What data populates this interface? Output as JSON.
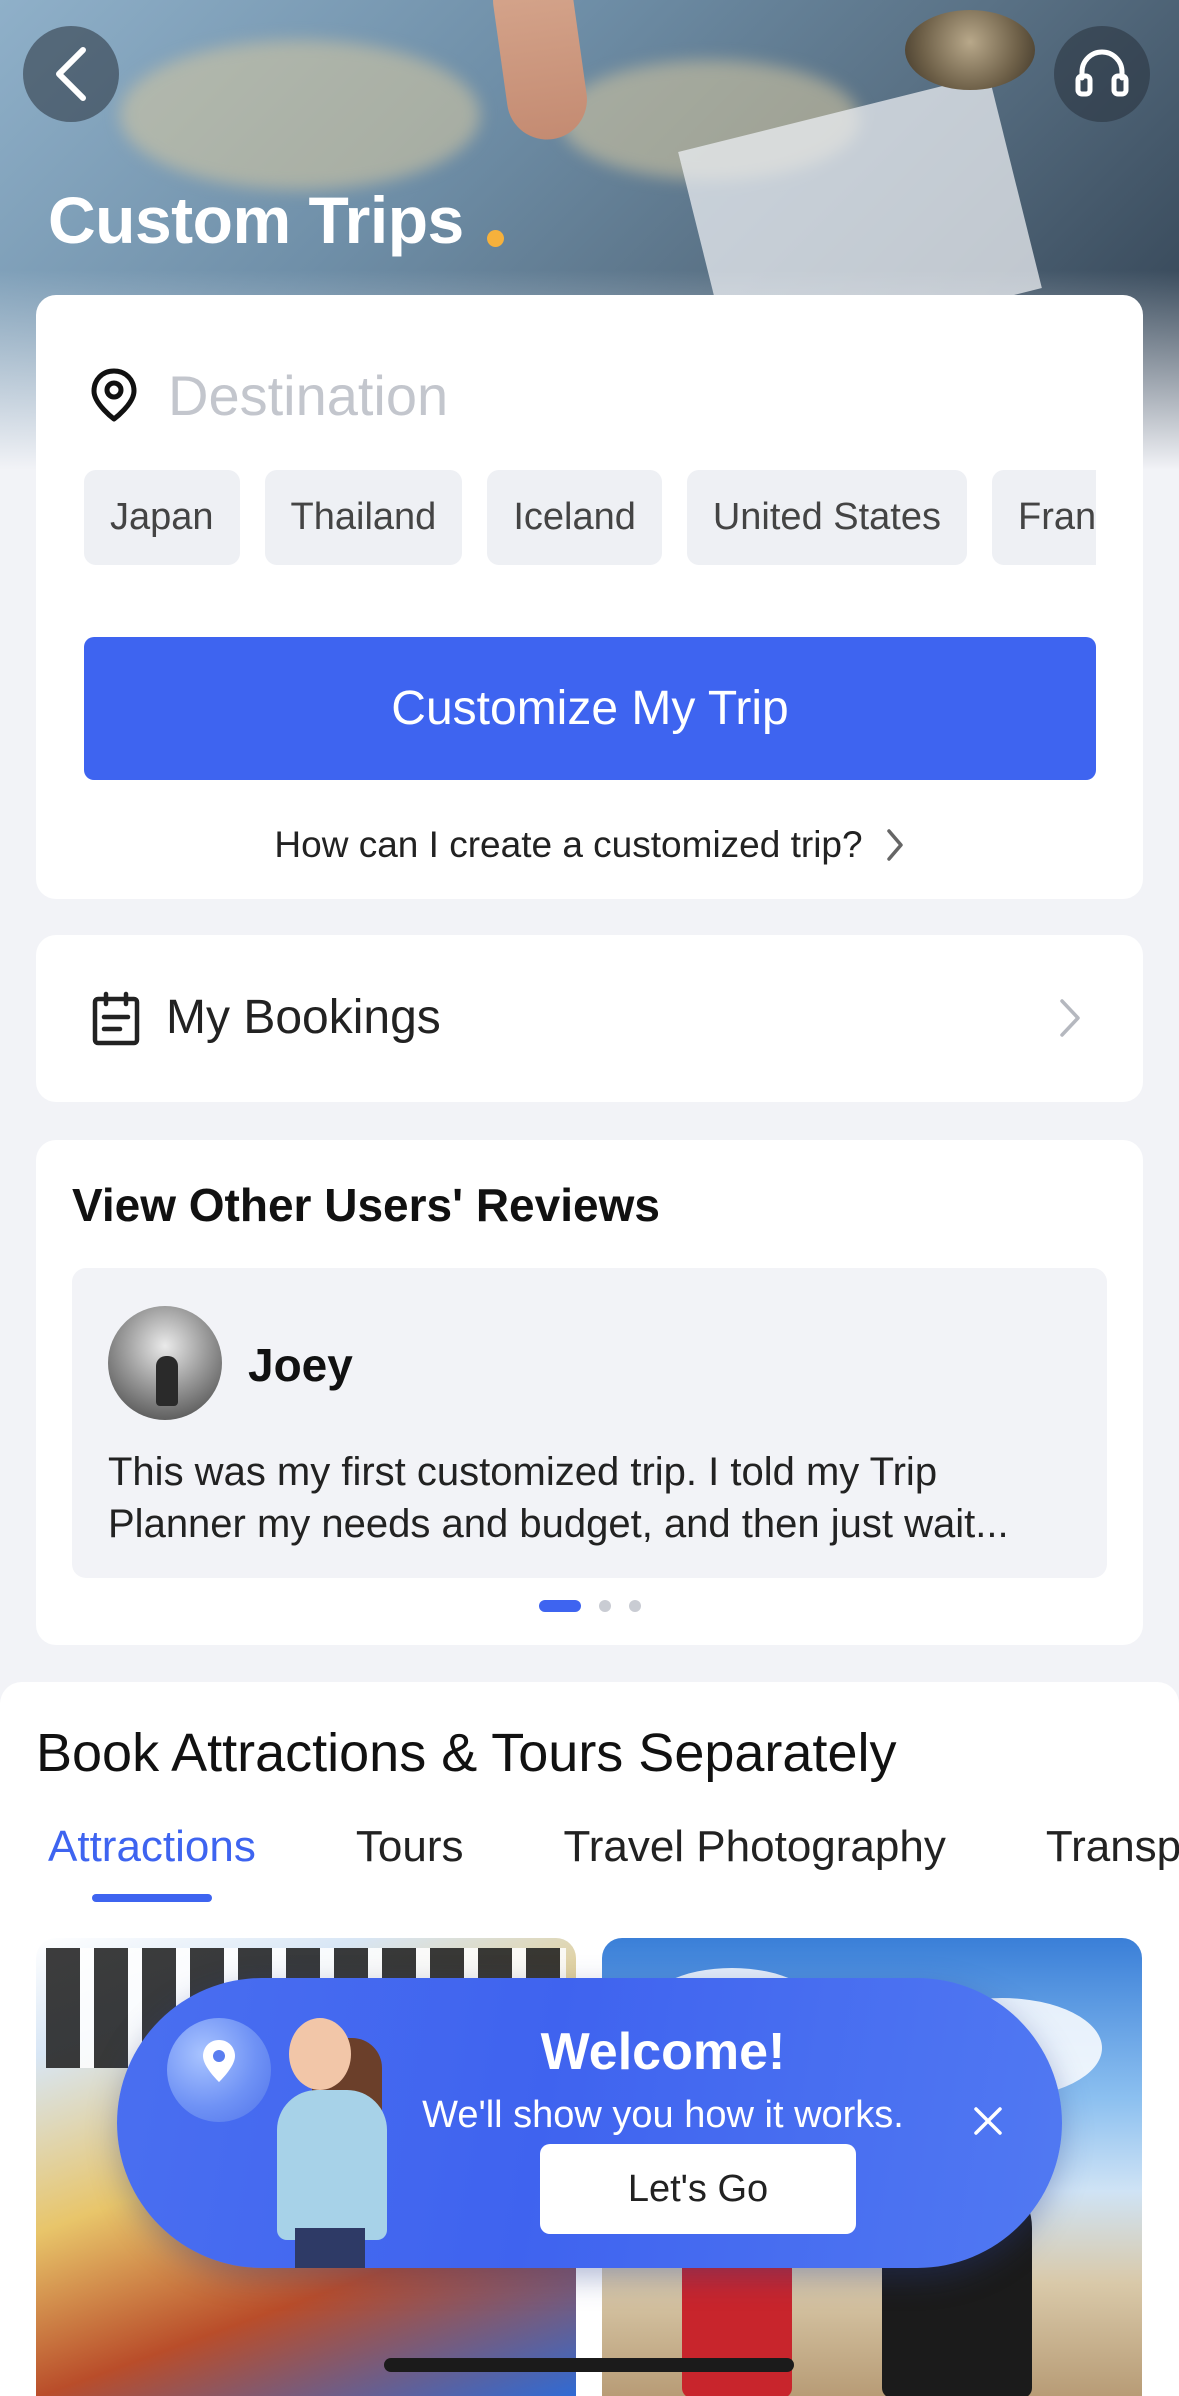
{
  "header": {
    "title": "Custom Trips",
    "accent_color": "#f6b13c",
    "back_icon": "chevron-left-icon",
    "support_icon": "headset-icon"
  },
  "search": {
    "placeholder": "Destination",
    "location_icon": "location-pin-icon",
    "chips": [
      "Japan",
      "Thailand",
      "Iceland",
      "United States",
      "Franc"
    ],
    "primary_button": "Customize My Trip",
    "help_link": "How can I create a customized trip?",
    "brand_color": "#3e64f0"
  },
  "bookings": {
    "label": "My Bookings",
    "icon": "clipboard-icon"
  },
  "reviews": {
    "title": "View Other Users' Reviews",
    "reviewer": "Joey",
    "text": "This was my first customized trip. I told my Trip Planner my needs and budget, and then just wait...",
    "page_count": 3,
    "active_page": 1
  },
  "attractions": {
    "title": "Book Attractions & Tours Separately",
    "tabs": [
      "Attractions",
      "Tours",
      "Travel Photography",
      "Transport"
    ],
    "active_tab": "Attractions"
  },
  "welcome": {
    "title": "Welcome!",
    "subtitle": "We'll show you how it works.",
    "button": "Let's Go",
    "close_icon": "close-icon"
  }
}
